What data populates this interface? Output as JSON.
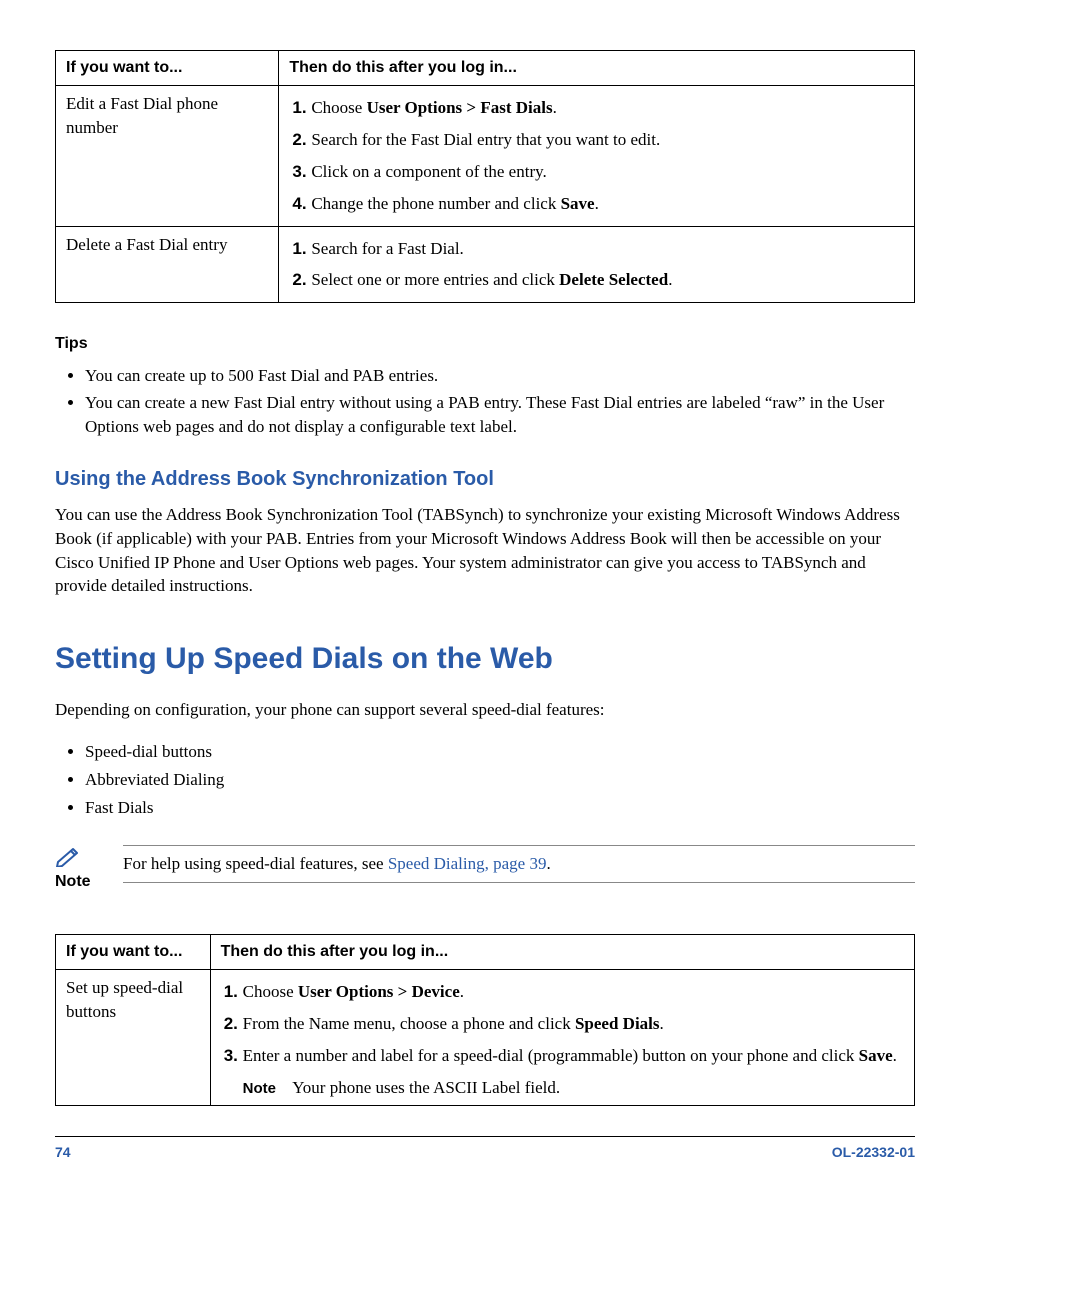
{
  "table1": {
    "header_left": "If you want to...",
    "header_right": "Then do this after you log in...",
    "rows": [
      {
        "task": "Edit a Fast Dial phone number",
        "steps": [
          "Choose <b>User Options > Fast Dials</b>.",
          "Search for the Fast Dial entry that you want to edit.",
          "Click on a component of the entry.",
          "Change the phone number and click <b>Save</b>."
        ]
      },
      {
        "task": "Delete a Fast Dial entry",
        "steps": [
          "Search for a Fast Dial.",
          "Select one or more entries and click <b>Delete Selected</b>."
        ]
      }
    ]
  },
  "tips_heading": "Tips",
  "tips": [
    "You can create up to 500 Fast Dial and PAB entries.",
    "You can create a new Fast Dial entry without using a PAB entry. These Fast Dial entries are labeled “raw” in the User Options web pages and do not display a configurable text label."
  ],
  "h3": "Using the Address Book Synchronization Tool",
  "p1": "You can use the Address Book Synchronization Tool (TABSynch) to synchronize your existing Microsoft Windows Address Book (if applicable) with your PAB. Entries from your Microsoft Windows Address Book will then be accessible on your Cisco Unified IP Phone and User Options web pages. Your system administrator can give you access to TABSynch and provide detailed instructions.",
  "h1": "Setting Up Speed Dials on the Web",
  "p2": "Depending on configuration, your phone can support several speed-dial features:",
  "features": [
    "Speed-dial buttons",
    "Abbreviated Dialing",
    "Fast Dials"
  ],
  "note_label": "Note",
  "note_text_prefix": "For help using speed-dial features, see ",
  "note_link": "Speed Dialing, page 39",
  "note_text_suffix": ".",
  "table2": {
    "header_left": "If you want to...",
    "header_right": "Then do this after you log in...",
    "row": {
      "task": "Set up speed-dial buttons",
      "steps": [
        "Choose <b>User Options > Device</b>.",
        "From the Name menu, choose a phone and click <b>Speed Dials</b>.",
        "Enter a number and label for a speed-dial (programmable) button on your phone and click <b>Save</b>."
      ],
      "note_label": "Note",
      "note_text": "Your phone uses the ASCII Label field."
    }
  },
  "footer": {
    "page": "74",
    "doc": "OL-22332-01"
  }
}
